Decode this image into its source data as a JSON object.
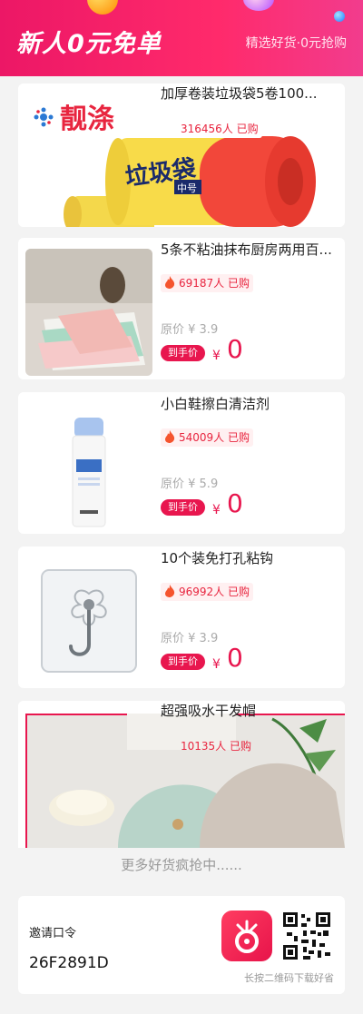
{
  "banner": {
    "title": "新人0元免单",
    "subtitle": "精选好货·0元抢购"
  },
  "products": [
    {
      "title": "加厚卷装垃圾袋5卷100...",
      "buyers": "316456人 已购",
      "brand": "靓涤",
      "pack_label": "垃圾袋",
      "pack_size": "中号"
    },
    {
      "title": "5条不粘油抹布厨房两用百...",
      "buyers": "69187人 已购",
      "original_price": "原价 ¥ 3.9",
      "tag": "到手价",
      "currency": "¥",
      "price": "0"
    },
    {
      "title": "小白鞋擦白清洁剂",
      "buyers": "54009人 已购",
      "original_price": "原价 ¥ 5.9",
      "tag": "到手价",
      "currency": "¥",
      "price": "0"
    },
    {
      "title": "10个装免打孔粘钩",
      "buyers": "96992人 已购",
      "original_price": "原价 ¥ 3.9",
      "tag": "到手价",
      "currency": "¥",
      "price": "0"
    },
    {
      "title": "超强吸水干发帽",
      "buyers": "10135人 已购"
    }
  ],
  "more_text": "更多好货疯抢中......",
  "invite": {
    "label": "邀请口令",
    "code": "26F2891D",
    "qr_caption": "长按二维码下载好省"
  },
  "colors": {
    "accent": "#e8164e",
    "banner": "#ec1766"
  }
}
